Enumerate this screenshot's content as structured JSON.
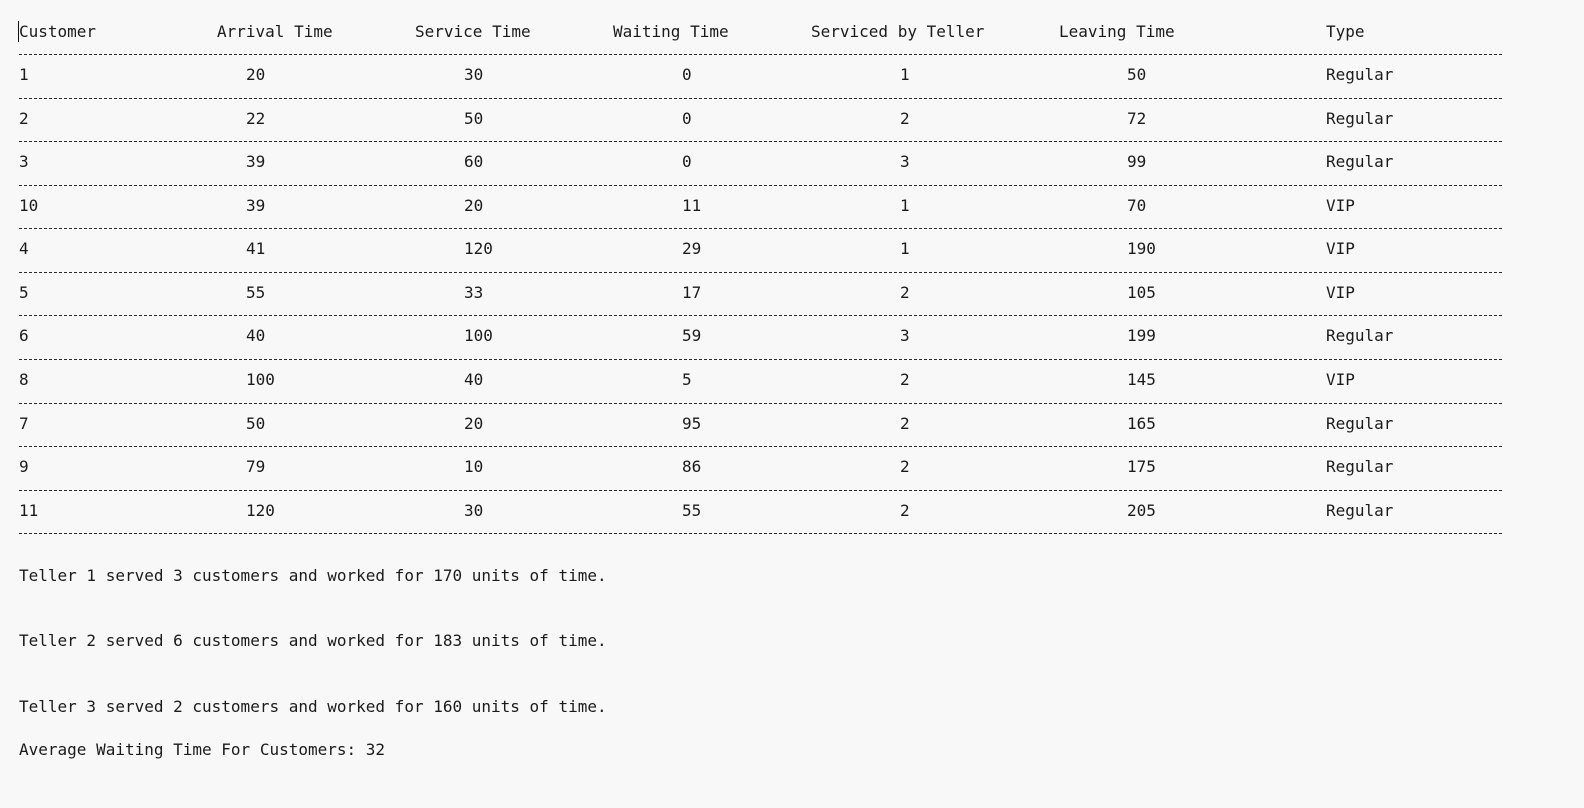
{
  "table": {
    "headers": [
      "Customer",
      "Arrival Time",
      "Service Time",
      "Waiting Time",
      "Serviced by Teller",
      "Leaving Time",
      "Type"
    ],
    "rows": [
      [
        "1",
        "20",
        "30",
        "0",
        "1",
        "50",
        "Regular"
      ],
      [
        "2",
        "22",
        "50",
        "0",
        "2",
        "72",
        "Regular"
      ],
      [
        "3",
        "39",
        "60",
        "0",
        "3",
        "99",
        "Regular"
      ],
      [
        "10",
        "39",
        "20",
        "11",
        "1",
        "70",
        "VIP"
      ],
      [
        "4",
        "41",
        "120",
        "29",
        "1",
        "190",
        "VIP"
      ],
      [
        "5",
        "55",
        "33",
        "17",
        "2",
        "105",
        "VIP"
      ],
      [
        "6",
        "40",
        "100",
        "59",
        "3",
        "199",
        "Regular"
      ],
      [
        "8",
        "100",
        "40",
        "5",
        "2",
        "145",
        "VIP"
      ],
      [
        "7",
        "50",
        "20",
        "95",
        "2",
        "165",
        "Regular"
      ],
      [
        "9",
        "79",
        "10",
        "86",
        "2",
        "175",
        "Regular"
      ],
      [
        "11",
        "120",
        "30",
        "55",
        "2",
        "205",
        "Regular"
      ]
    ]
  },
  "summary": {
    "teller_1": "Teller 1 served 3 customers and worked for 170 units of time.",
    "teller_2": "Teller 2 served 6 customers and worked for 183 units of time.",
    "teller_3": "Teller 3 served 2 customers and worked for 160 units of time.",
    "average": "Average Waiting Time For Customers: 32"
  }
}
